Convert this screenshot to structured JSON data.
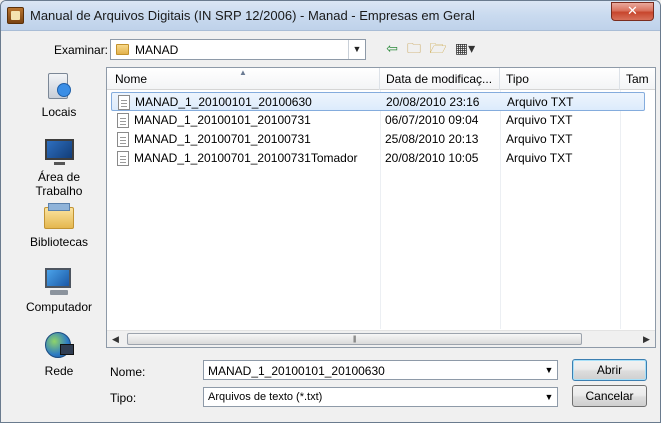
{
  "window": {
    "title": "Manual de Arquivos Digitais (IN SRP 12/2006) - Manad - Empresas em Geral",
    "close_glyph": "✕"
  },
  "lookin": {
    "label": "Examinar:",
    "value": "MANAD"
  },
  "toolbar": {
    "back_icon": "⇦",
    "up_icon": "🗀",
    "newfolder_icon": "🗁",
    "views_icon": "▦▾"
  },
  "places": [
    {
      "name": "recent-places",
      "label": "Locais",
      "icon": "recent-places-icon"
    },
    {
      "name": "desktop",
      "label": "Área de\nTrabalho",
      "icon": "desktop-icon"
    },
    {
      "name": "libraries",
      "label": "Bibliotecas",
      "icon": "libraries-icon"
    },
    {
      "name": "computer",
      "label": "Computador",
      "icon": "computer-icon"
    },
    {
      "name": "network",
      "label": "Rede",
      "icon": "network-icon"
    }
  ],
  "columns": {
    "name": "Nome",
    "date": "Data de modificaç...",
    "type": "Tipo",
    "size": "Tam"
  },
  "files": [
    {
      "name": "MANAD_1_20100101_20100630",
      "date": "20/08/2010 23:16",
      "type": "Arquivo TXT",
      "selected": true
    },
    {
      "name": "MANAD_1_20100101_20100731",
      "date": "06/07/2010 09:04",
      "type": "Arquivo TXT",
      "selected": false
    },
    {
      "name": "MANAD_1_20100701_20100731",
      "date": "25/08/2010 20:13",
      "type": "Arquivo TXT",
      "selected": false
    },
    {
      "name": "MANAD_1_20100701_20100731Tomador",
      "date": "20/08/2010 10:05",
      "type": "Arquivo TXT",
      "selected": false
    }
  ],
  "scroll": {
    "left": "◀",
    "right": "▶",
    "grip": "|||"
  },
  "filename": {
    "label": "Nome:",
    "value": "MANAD_1_20100101_20100630"
  },
  "filetype": {
    "label": "Tipo:",
    "value": "Arquivos de texto (*.txt)"
  },
  "buttons": {
    "open": "Abrir",
    "cancel": "Cancelar"
  },
  "colors": {
    "selection_border": "#84acdd",
    "title_gradient_top": "#dbe6f4"
  }
}
